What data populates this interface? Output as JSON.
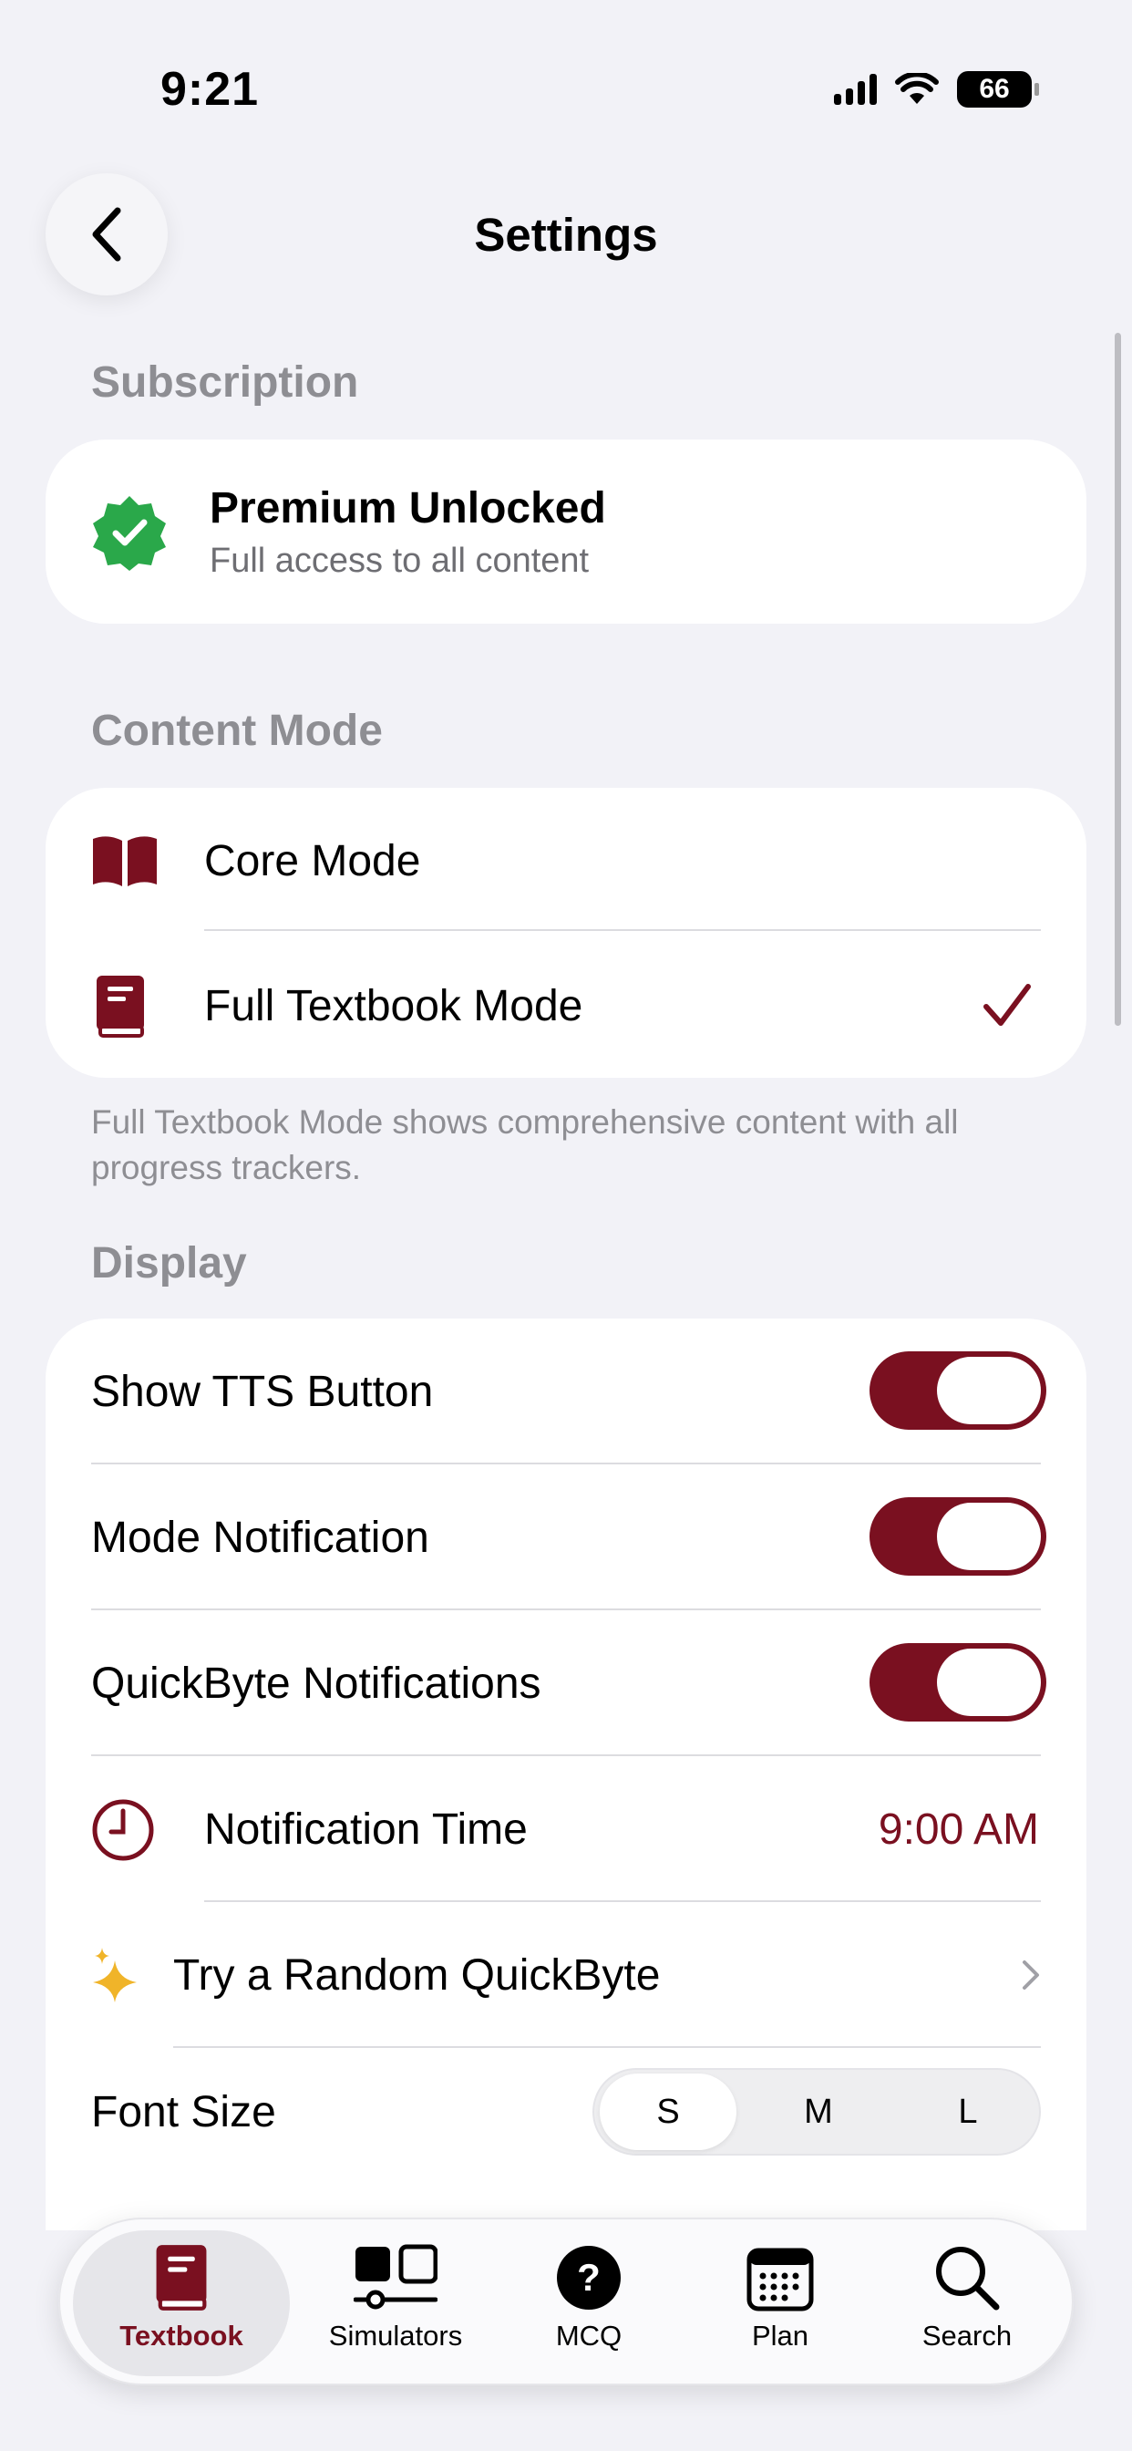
{
  "status_bar": {
    "time": "9:21",
    "battery": "66"
  },
  "header": {
    "title": "Settings"
  },
  "subscription": {
    "section_title": "Subscription",
    "title": "Premium Unlocked",
    "subtitle": "Full access to all content"
  },
  "content_mode": {
    "section_title": "Content Mode",
    "options": [
      {
        "label": "Core Mode",
        "selected": false
      },
      {
        "label": "Full Textbook Mode",
        "selected": true
      }
    ],
    "footnote": "Full Textbook Mode shows comprehensive content with all progress trackers."
  },
  "display": {
    "section_title": "Display",
    "toggles": [
      {
        "label": "Show TTS Button",
        "on": true
      },
      {
        "label": "Mode Notification",
        "on": true
      },
      {
        "label": "QuickByte Notifications",
        "on": true
      }
    ],
    "notification_time": {
      "label": "Notification Time",
      "value": "9:00 AM"
    },
    "random_quickbyte": {
      "label": "Try a Random QuickByte"
    },
    "font_size": {
      "label": "Font Size",
      "options": [
        "S",
        "M",
        "L"
      ],
      "selected": "S"
    }
  },
  "tab_bar": {
    "tabs": [
      {
        "label": "Textbook",
        "active": true
      },
      {
        "label": "Simulators",
        "active": false
      },
      {
        "label": "MCQ",
        "active": false
      },
      {
        "label": "Plan",
        "active": false
      },
      {
        "label": "Search",
        "active": false
      }
    ]
  },
  "colors": {
    "accent": "#7a1020",
    "verified_green": "#2aa84a",
    "sparkle_yellow": "#f0b429",
    "background": "#f2f2f7"
  }
}
